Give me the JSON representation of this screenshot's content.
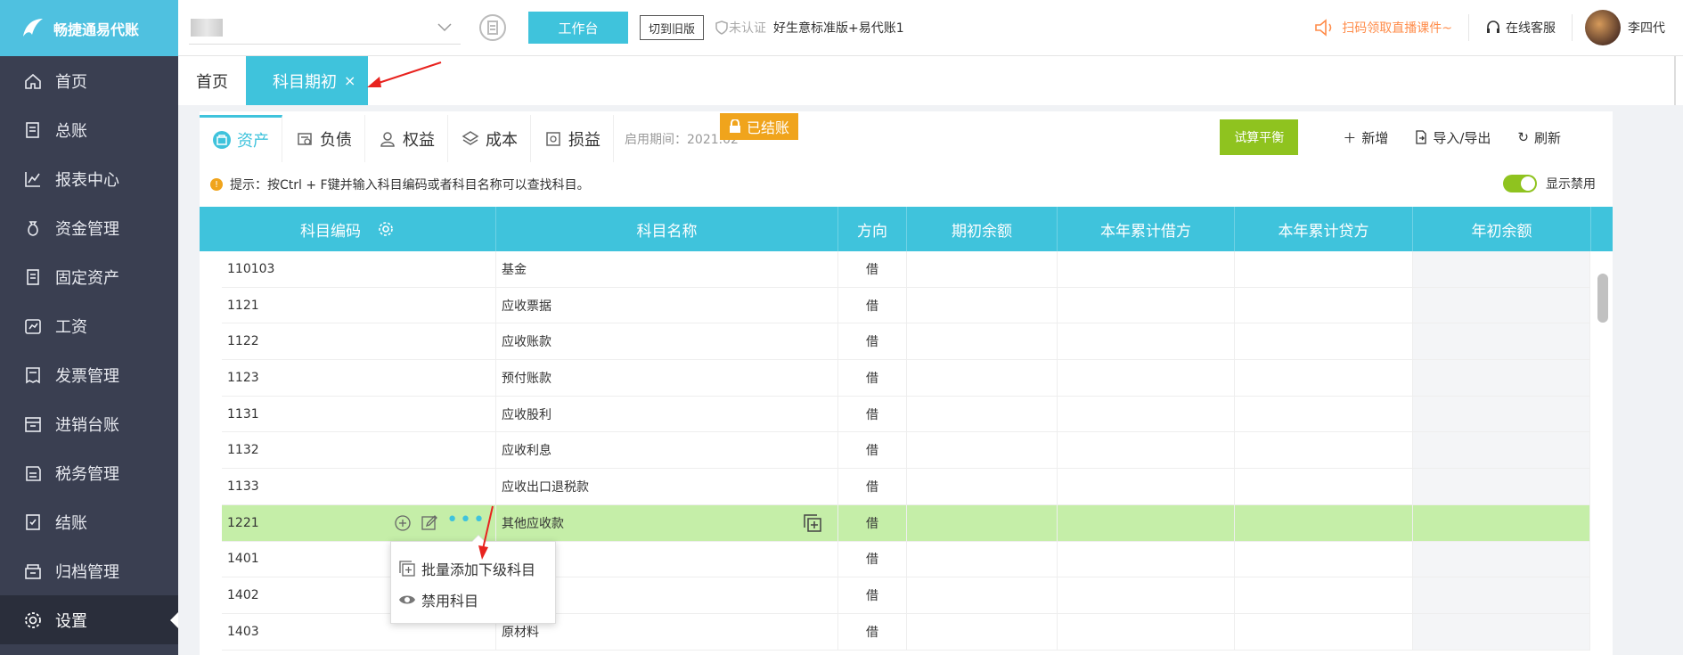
{
  "app": {
    "name": "畅捷通易代账"
  },
  "sidebar": {
    "items": [
      {
        "label": "首页",
        "icon": "home-icon"
      },
      {
        "label": "总账",
        "icon": "ledger-icon"
      },
      {
        "label": "报表中心",
        "icon": "chart-icon"
      },
      {
        "label": "资金管理",
        "icon": "money-bag-icon"
      },
      {
        "label": "固定资产",
        "icon": "building-icon"
      },
      {
        "label": "工资",
        "icon": "salary-icon"
      },
      {
        "label": "发票管理",
        "icon": "invoice-icon"
      },
      {
        "label": "进销台账",
        "icon": "inventory-icon"
      },
      {
        "label": "税务管理",
        "icon": "tax-icon"
      },
      {
        "label": "结账",
        "icon": "checkout-icon"
      },
      {
        "label": "归档管理",
        "icon": "archive-icon"
      },
      {
        "label": "设置",
        "icon": "gear-icon",
        "active": true
      }
    ]
  },
  "topbar": {
    "workbench_label": "工作台",
    "switch_label": "切到旧版",
    "unverified_label": "未认证",
    "version_label": "好生意标准版+易代账1",
    "promo_label": "扫码领取直播课件~",
    "service_label": "在线客服",
    "user_name": "李四代"
  },
  "page_tabs": [
    {
      "label": "首页",
      "active": false
    },
    {
      "label": "科目期初",
      "active": true,
      "close": "×"
    }
  ],
  "category_tabs": [
    {
      "label": "资产",
      "active": true
    },
    {
      "label": "负债"
    },
    {
      "label": "权益"
    },
    {
      "label": "成本"
    },
    {
      "label": "损益"
    }
  ],
  "period_label": "启用期间：2021.02",
  "closed_badge": "已结账",
  "toolbar": {
    "trial_balance": "试算平衡",
    "add": "新增",
    "import_export": "导入/导出",
    "refresh": "刷新"
  },
  "tip": "提示：按Ctrl + F键并输入科目编码或者科目名称可以查找科目。",
  "show_disabled_label": "显示禁用",
  "table": {
    "columns": [
      "科目编码",
      "科目名称",
      "方向",
      "期初余额",
      "本年累计借方",
      "本年累计贷方",
      "年初余额"
    ],
    "rows": [
      {
        "code": "110103",
        "name": "基金",
        "dir": "借"
      },
      {
        "code": "1121",
        "name": "应收票据",
        "dir": "借"
      },
      {
        "code": "1122",
        "name": "应收账款",
        "dir": "借"
      },
      {
        "code": "1123",
        "name": "预付账款",
        "dir": "借"
      },
      {
        "code": "1131",
        "name": "应收股利",
        "dir": "借"
      },
      {
        "code": "1132",
        "name": "应收利息",
        "dir": "借"
      },
      {
        "code": "1133",
        "name": "应收出口退税款",
        "dir": "借"
      },
      {
        "code": "1221",
        "name": "其他应收款",
        "dir": "借",
        "selected": true
      },
      {
        "code": "1401",
        "name": "",
        "dir": "借"
      },
      {
        "code": "1402",
        "name": "",
        "dir": "借"
      },
      {
        "code": "1403",
        "name": "原材料",
        "dir": "借"
      }
    ]
  },
  "popup_menu": {
    "items": [
      {
        "label": "批量添加下级科目",
        "icon": "batch-add-icon"
      },
      {
        "label": "禁用科目",
        "icon": "eye-icon"
      }
    ]
  },
  "colors": {
    "accent": "#3fc3dc",
    "sidebar_bg": "#3a3f51",
    "selected_row": "#c5eea8",
    "badge": "#f0a41c",
    "primary_green": "#8fc31f"
  }
}
